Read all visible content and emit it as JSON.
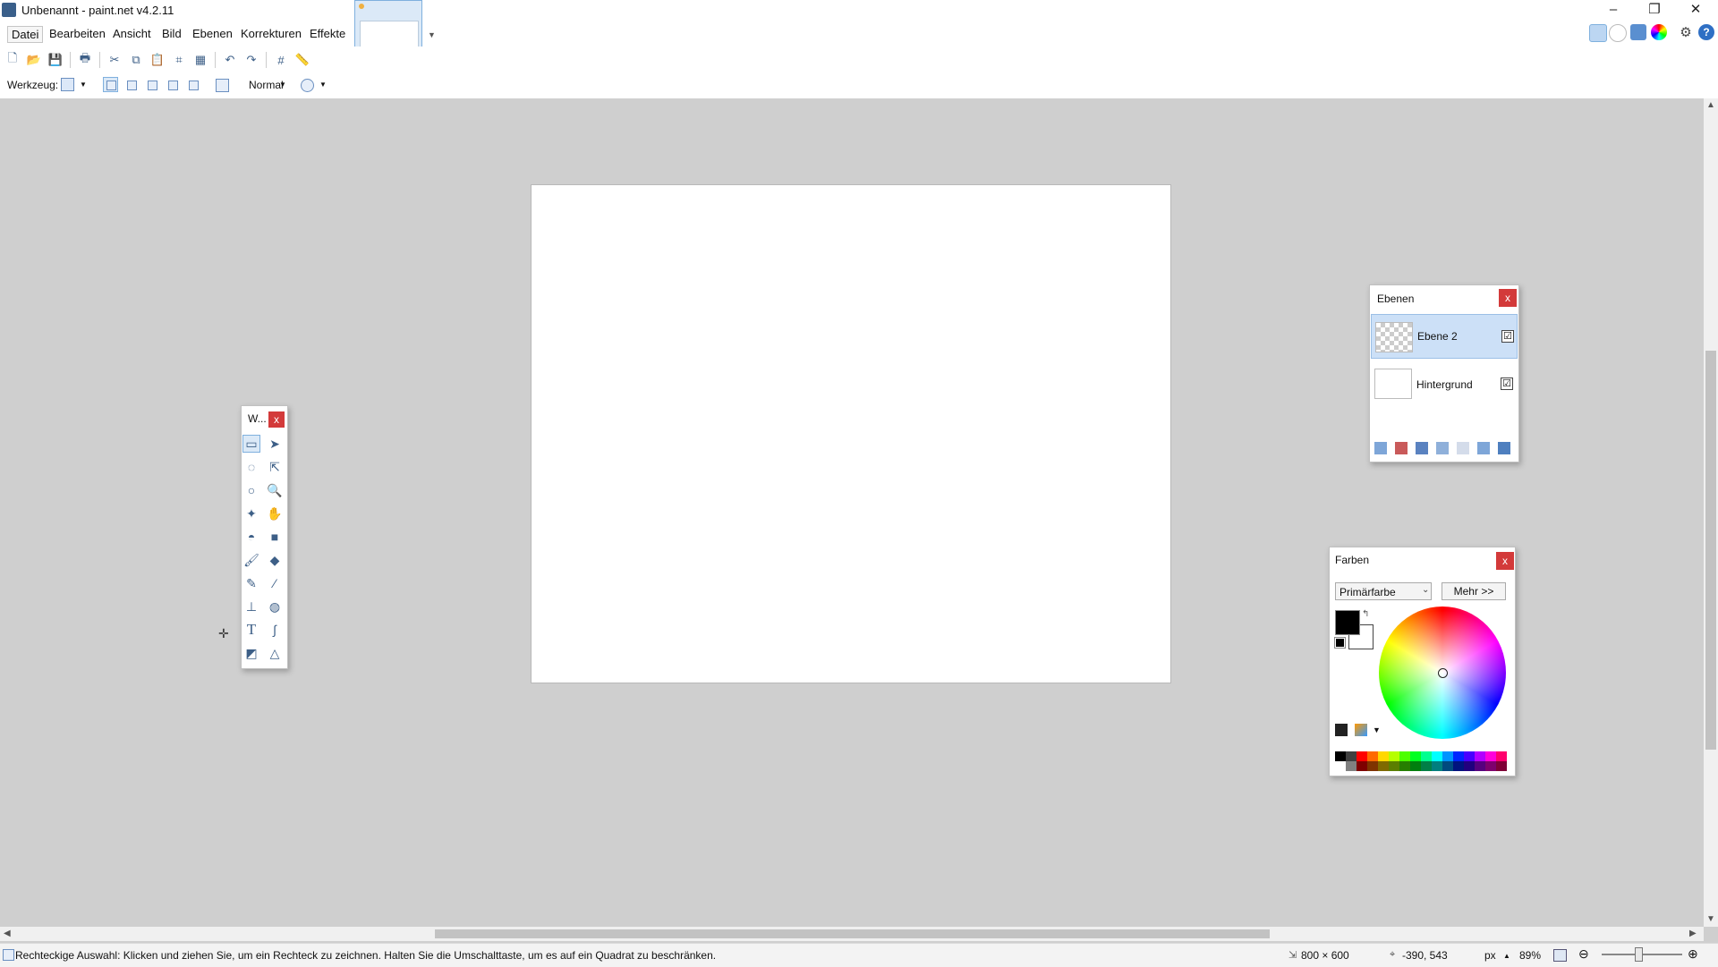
{
  "window": {
    "title": "Unbenannt - paint.net v4.2.11",
    "minimize": "–",
    "maximize": "❐",
    "close": "✕"
  },
  "menu": [
    "Datei",
    "Bearbeiten",
    "Ansicht",
    "Bild",
    "Ebenen",
    "Korrekturen",
    "Effekte"
  ],
  "toolbar2": {
    "tool_label": "Werkzeug:",
    "blend_mode": "Normal"
  },
  "tools_window": {
    "title": "W...",
    "close": "x"
  },
  "layers": {
    "title": "Ebenen",
    "close": "x",
    "items": [
      {
        "name": "Ebene 2",
        "visible": "☑"
      },
      {
        "name": "Hintergrund",
        "visible": "☑"
      }
    ]
  },
  "colors": {
    "title": "Farben",
    "close": "x",
    "mode": "Primärfarbe",
    "more_label": "Mehr >>",
    "primary": "#000000",
    "secondary": "#ffffff",
    "palette_top": [
      "#000000",
      "#404040",
      "#ff0000",
      "#ff6a00",
      "#ffd800",
      "#b6ff00",
      "#4cff00",
      "#00ff21",
      "#00ff90",
      "#00ffff",
      "#0094ff",
      "#0026ff",
      "#4800ff",
      "#b200ff",
      "#ff00dc",
      "#ff006e"
    ],
    "palette_bottom": [
      "#ffffff",
      "#808080",
      "#7f0000",
      "#7f3300",
      "#7f6a00",
      "#5b7f00",
      "#267f00",
      "#007f0e",
      "#007f46",
      "#007f7f",
      "#004a7f",
      "#00137f",
      "#21007f",
      "#57007f",
      "#7f006e",
      "#7f0037"
    ]
  },
  "status": {
    "message": "Rechteckige Auswahl: Klicken und ziehen Sie, um ein Rechteck zu zeichnen. Halten Sie die Umschalttaste, um es auf ein Quadrat zu beschränken.",
    "image_size": "800 × 600",
    "cursor_pos": "-390, 543",
    "unit": "px",
    "zoom": "89%",
    "zoom_level": 0.45
  }
}
